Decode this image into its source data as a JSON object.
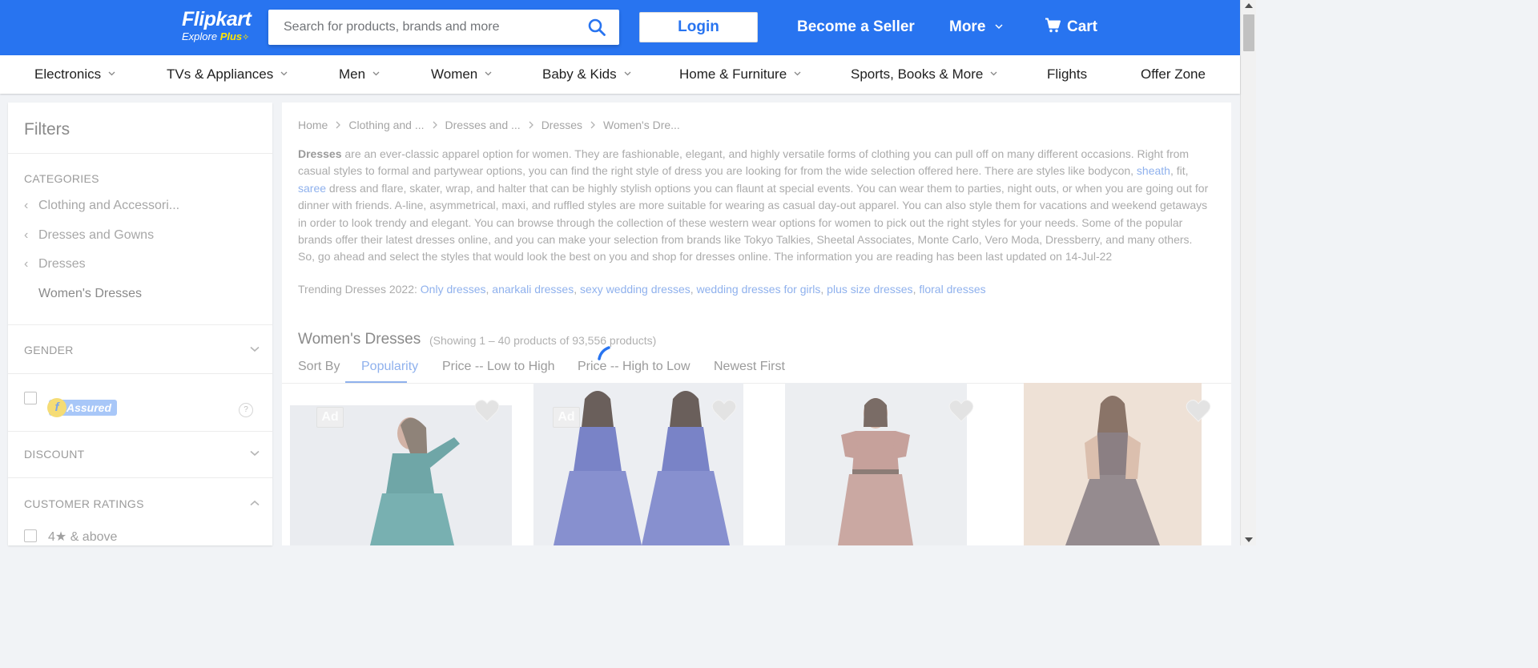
{
  "header": {
    "logo": "Flipkart",
    "logo_sub_prefix": "Explore",
    "logo_sub_plus": "Plus",
    "search_placeholder": "Search for products, brands and more",
    "login": "Login",
    "become_seller": "Become a Seller",
    "more": "More",
    "cart": "Cart",
    "colors": {
      "brand": "#2874f0",
      "plus_yellow": "#ffe500"
    }
  },
  "category_nav": [
    {
      "label": "Electronics",
      "dropdown": true
    },
    {
      "label": "TVs & Appliances",
      "dropdown": true
    },
    {
      "label": "Men",
      "dropdown": true
    },
    {
      "label": "Women",
      "dropdown": true
    },
    {
      "label": "Baby & Kids",
      "dropdown": true
    },
    {
      "label": "Home & Furniture",
      "dropdown": true
    },
    {
      "label": "Sports, Books & More",
      "dropdown": true
    },
    {
      "label": "Flights",
      "dropdown": false
    },
    {
      "label": "Offer Zone",
      "dropdown": false
    }
  ],
  "sidebar": {
    "title": "Filters",
    "categories_heading": "CATEGORIES",
    "categories": [
      "Clothing and Accessori...",
      "Dresses and Gowns",
      "Dresses",
      "Women's Dresses"
    ],
    "gender_heading": "GENDER",
    "assured_letter": "f",
    "assured_label": "Assured",
    "help": "?",
    "discount_heading": "DISCOUNT",
    "ratings_heading": "CUSTOMER RATINGS",
    "rating_option": "4★ & above"
  },
  "main": {
    "breadcrumb": [
      "Home",
      "Clothing and ...",
      "Dresses and ...",
      "Dresses",
      "Women's Dre..."
    ],
    "description": {
      "bold_start": "Dresses",
      "part1": " are an ever-classic apparel option for women. They are fashionable, elegant, and highly versatile forms of clothing you can pull off on many different occasions. Right from casual styles to formal and partywear options, you can find the right style of dress you are looking for from the wide selection offered here. There are styles like bodycon, ",
      "link_sheath": "sheath",
      "part2": ", fit, ",
      "link_saree": "saree",
      "part3": " dress and flare, skater, wrap, and halter that can be highly stylish options you can flaunt at special events. You can wear them to parties, night outs, or when you are going out for dinner with friends. A-line, asymmetrical, maxi, and ruffled styles are more suitable for wearing as casual day-out apparel. You can also style them for vacations and weekend getaways in order to look trendy and elegant. You can browse through the collection of these western wear options for women to pick out the right styles for your needs. Some of the popular brands offer their latest dresses online, and you can make your selection from brands like Tokyo Talkies, Sheetal Associates, Monte Carlo, Vero Moda, Dressberry, and many others. So, go ahead and select the styles that would look the best on you and shop for dresses online. The information you are reading has been last updated on 14-Jul-22"
    },
    "trending_label": "Trending Dresses 2022: ",
    "trending_links": [
      "Only dresses",
      "anarkali dresses",
      "sexy wedding dresses",
      "wedding dresses for girls",
      "plus size dresses",
      "floral dresses"
    ],
    "results_title": "Women's Dresses",
    "results_count": "(Showing 1 – 40 products of 93,556 products)",
    "sort_label": "Sort By",
    "sort_options": [
      "Popularity",
      "Price -- Low to High",
      "Price -- High to Low",
      "Newest First"
    ],
    "sort_active": "Popularity",
    "ad_label": "Ad"
  }
}
